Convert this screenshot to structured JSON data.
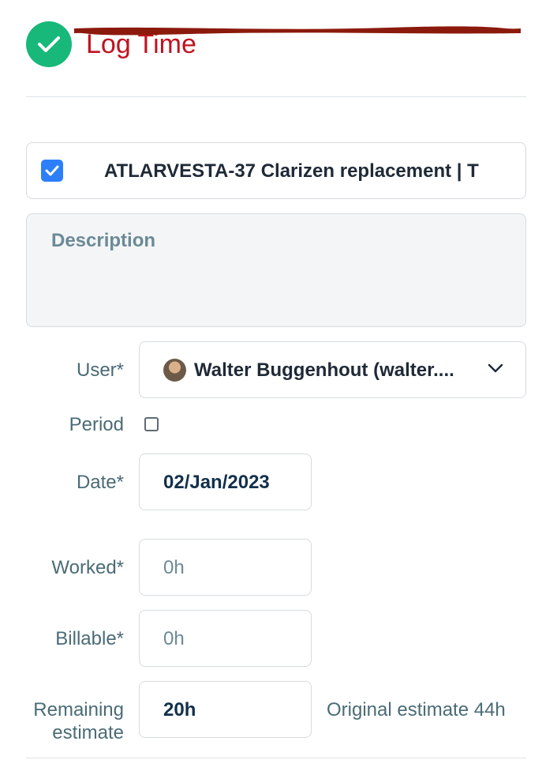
{
  "header": {
    "title": "Log Time",
    "icon": "check-circle-icon",
    "accent_color": "#c1121f",
    "icon_color": "#18b87a"
  },
  "issue": {
    "checked": true,
    "text": "ATLARVESTA-37 Clarizen replacement | T"
  },
  "description": {
    "placeholder": "Description",
    "value": ""
  },
  "form": {
    "user": {
      "label": "User*",
      "value": "Walter Buggenhout (walter....",
      "icon": "chevron-down-icon"
    },
    "period": {
      "label": "Period",
      "checked": false
    },
    "date": {
      "label": "Date*",
      "value": "02/Jan/2023"
    },
    "worked": {
      "label": "Worked*",
      "placeholder": "0h"
    },
    "billable": {
      "label": "Billable*",
      "placeholder": "0h"
    },
    "remaining": {
      "label_line1": "Remaining",
      "label_line2": "estimate",
      "value": "20h",
      "original_estimate": "Original estimate 44h"
    }
  }
}
